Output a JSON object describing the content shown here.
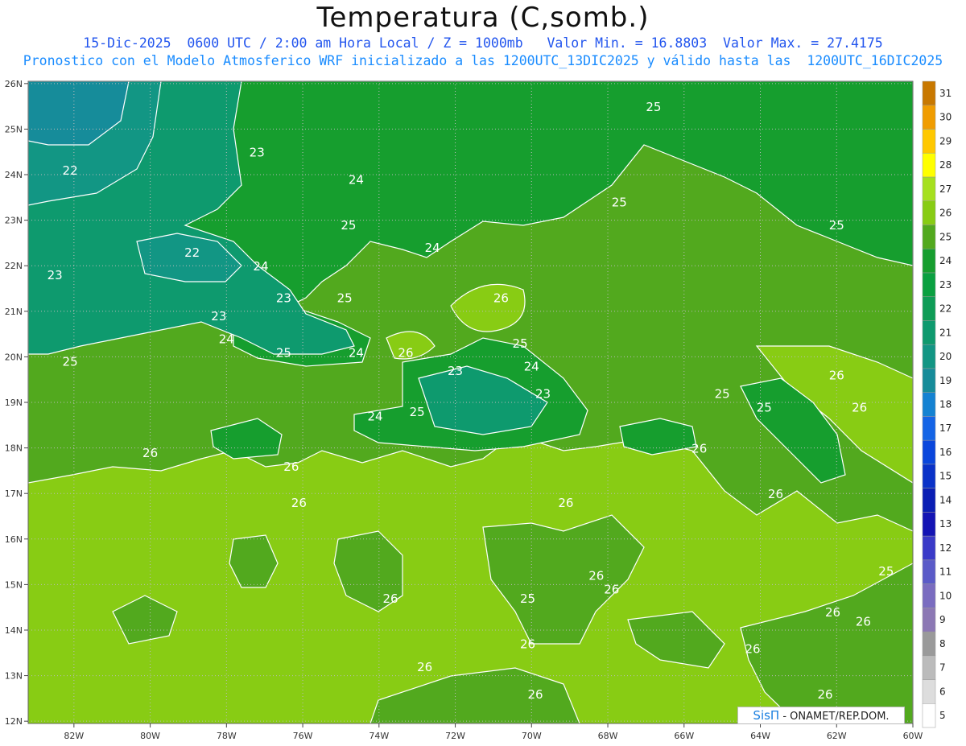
{
  "header": {
    "title": "Temperatura (C,somb.)",
    "line1": "15-Dic-2025  0600 UTC / 2:00 am Hora Local / Z = 1000mb   Valor Min. = 16.8803  Valor Max. = 27.4175",
    "line2": "Pronostico con el Modelo Atmosferico WRF inicializado a las 1200UTC_13DIC2025 y válido hasta las  1200UTC_16DIC2025"
  },
  "map": {
    "lon_labels": [
      "82W",
      "80W",
      "78W",
      "76W",
      "74W",
      "72W",
      "70W",
      "68W",
      "66W",
      "64W",
      "62W",
      "60W"
    ],
    "lat_labels": [
      "12N",
      "13N",
      "14N",
      "15N",
      "16N",
      "17N",
      "18N",
      "19N",
      "20N",
      "21N",
      "22N",
      "23N",
      "24N",
      "25N",
      "26N"
    ],
    "grid": true,
    "contour_labels": [
      {
        "t": "22",
        "lon": -82.1,
        "lat": 24.0
      },
      {
        "t": "23",
        "lon": -77.2,
        "lat": 24.4
      },
      {
        "t": "24",
        "lon": -74.6,
        "lat": 23.8
      },
      {
        "t": "25",
        "lon": -74.8,
        "lat": 22.8
      },
      {
        "t": "22",
        "lon": -78.9,
        "lat": 22.2
      },
      {
        "t": "23",
        "lon": -82.5,
        "lat": 21.7
      },
      {
        "t": "24",
        "lon": -77.1,
        "lat": 21.9
      },
      {
        "t": "23",
        "lon": -76.5,
        "lat": 21.2
      },
      {
        "t": "25",
        "lon": -74.9,
        "lat": 21.2
      },
      {
        "t": "23",
        "lon": -78.2,
        "lat": 20.8
      },
      {
        "t": "24",
        "lon": -78.0,
        "lat": 20.3
      },
      {
        "t": "25",
        "lon": -76.5,
        "lat": 20.0
      },
      {
        "t": "24",
        "lon": -74.6,
        "lat": 20.0
      },
      {
        "t": "26",
        "lon": -73.3,
        "lat": 20.0
      },
      {
        "t": "25",
        "lon": -82.1,
        "lat": 19.8
      },
      {
        "t": "25",
        "lon": -70.3,
        "lat": 20.2
      },
      {
        "t": "24",
        "lon": -70.0,
        "lat": 19.7
      },
      {
        "t": "23",
        "lon": -72.0,
        "lat": 19.6
      },
      {
        "t": "23",
        "lon": -69.7,
        "lat": 19.1
      },
      {
        "t": "24",
        "lon": -74.1,
        "lat": 18.6
      },
      {
        "t": "25",
        "lon": -73.0,
        "lat": 18.7
      },
      {
        "t": "26",
        "lon": -70.8,
        "lat": 21.2
      },
      {
        "t": "25",
        "lon": -67.7,
        "lat": 23.3
      },
      {
        "t": "25",
        "lon": -66.8,
        "lat": 25.4
      },
      {
        "t": "24",
        "lon": -72.6,
        "lat": 22.3
      },
      {
        "t": "25",
        "lon": -62.0,
        "lat": 22.8
      },
      {
        "t": "25",
        "lon": -65.0,
        "lat": 19.1
      },
      {
        "t": "25",
        "lon": -63.9,
        "lat": 18.8
      },
      {
        "t": "26",
        "lon": -62.0,
        "lat": 19.5
      },
      {
        "t": "26",
        "lon": -61.4,
        "lat": 18.8
      },
      {
        "t": "26",
        "lon": -65.6,
        "lat": 17.9
      },
      {
        "t": "26",
        "lon": -80.0,
        "lat": 17.8
      },
      {
        "t": "26",
        "lon": -76.3,
        "lat": 17.5
      },
      {
        "t": "26",
        "lon": -76.1,
        "lat": 16.7
      },
      {
        "t": "26",
        "lon": -63.6,
        "lat": 16.9
      },
      {
        "t": "26",
        "lon": -69.1,
        "lat": 16.7
      },
      {
        "t": "26",
        "lon": -68.3,
        "lat": 15.1
      },
      {
        "t": "26",
        "lon": -67.9,
        "lat": 14.8
      },
      {
        "t": "25",
        "lon": -70.1,
        "lat": 14.6
      },
      {
        "t": "26",
        "lon": -73.7,
        "lat": 14.6
      },
      {
        "t": "25",
        "lon": -60.7,
        "lat": 15.2
      },
      {
        "t": "26",
        "lon": -62.1,
        "lat": 14.3
      },
      {
        "t": "26",
        "lon": -61.3,
        "lat": 14.1
      },
      {
        "t": "26",
        "lon": -70.1,
        "lat": 13.6
      },
      {
        "t": "26",
        "lon": -72.8,
        "lat": 13.1
      },
      {
        "t": "26",
        "lon": -64.2,
        "lat": 13.5
      },
      {
        "t": "26",
        "lon": -62.3,
        "lat": 12.5
      },
      {
        "t": "26",
        "lon": -69.9,
        "lat": 12.5
      }
    ]
  },
  "colorbar": {
    "labels": [
      "5",
      "6",
      "7",
      "8",
      "9",
      "10",
      "11",
      "12",
      "13",
      "14",
      "15",
      "16",
      "17",
      "18",
      "19",
      "20",
      "21",
      "22",
      "23",
      "24",
      "25",
      "26",
      "27",
      "28",
      "29",
      "30",
      "31"
    ],
    "colors": [
      "#ffffff",
      "#dddddd",
      "#bbbbbb",
      "#9a9a9a",
      "#8c78b4",
      "#7a6cc0",
      "#5b5bc8",
      "#3a3ac8",
      "#1414b4",
      "#0a1eb4",
      "#0a32c8",
      "#0a46dc",
      "#1464e6",
      "#1482d2",
      "#168c9a",
      "#129684",
      "#0e9a6e",
      "#0e9c56",
      "#0aa040",
      "#169e2e",
      "#52a91e",
      "#88cc14",
      "#a6e01e",
      "#ffff00",
      "#ffc800",
      "#f09c00",
      "#c87800"
    ]
  },
  "credit": {
    "brand": "SisΠ",
    "text": " - ONAMET/REP.DOM."
  },
  "colors": {
    "lvl22": "#129684",
    "lvl23": "#0e9a6e",
    "lvl24": "#169e2e",
    "lvl25": "#52a91e",
    "lvl26": "#88cc14",
    "lvl27": "#a6e01e"
  }
}
